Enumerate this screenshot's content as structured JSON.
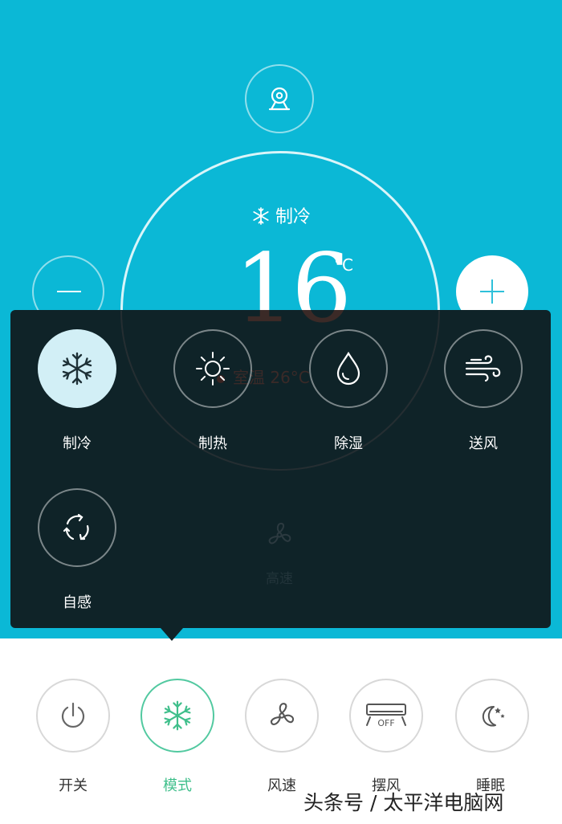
{
  "header": {
    "mode_label": "制冷",
    "target_temp": "16",
    "temp_unit": "°C"
  },
  "background_ghost": {
    "room_temp": "室温 26°C",
    "fan_speed": "高速"
  },
  "mode_menu": {
    "options": [
      {
        "label": "制冷",
        "icon": "snowflake-icon",
        "selected": true
      },
      {
        "label": "制热",
        "icon": "sun-icon",
        "selected": false
      },
      {
        "label": "除湿",
        "icon": "droplet-icon",
        "selected": false
      },
      {
        "label": "送风",
        "icon": "wind-icon",
        "selected": false
      },
      {
        "label": "自感",
        "icon": "auto-cycle-icon",
        "selected": false
      }
    ]
  },
  "bottom_bar": {
    "items": [
      {
        "label": "开关",
        "icon": "power-icon",
        "active": false
      },
      {
        "label": "模式",
        "icon": "snowflake-icon",
        "active": true
      },
      {
        "label": "风速",
        "icon": "fan-icon",
        "active": false
      },
      {
        "label": "摆风",
        "icon": "swing-off-icon",
        "active": false,
        "badge": "OFF"
      },
      {
        "label": "睡眠",
        "icon": "moon-stars-icon",
        "active": false
      }
    ]
  },
  "watermark": "头条号 / 太平洋电脑网",
  "colors": {
    "primary": "#0bb8d6",
    "overlay": "#0f2328",
    "accent_green": "#3fbf8b",
    "selected_bg": "#d2eff6"
  }
}
